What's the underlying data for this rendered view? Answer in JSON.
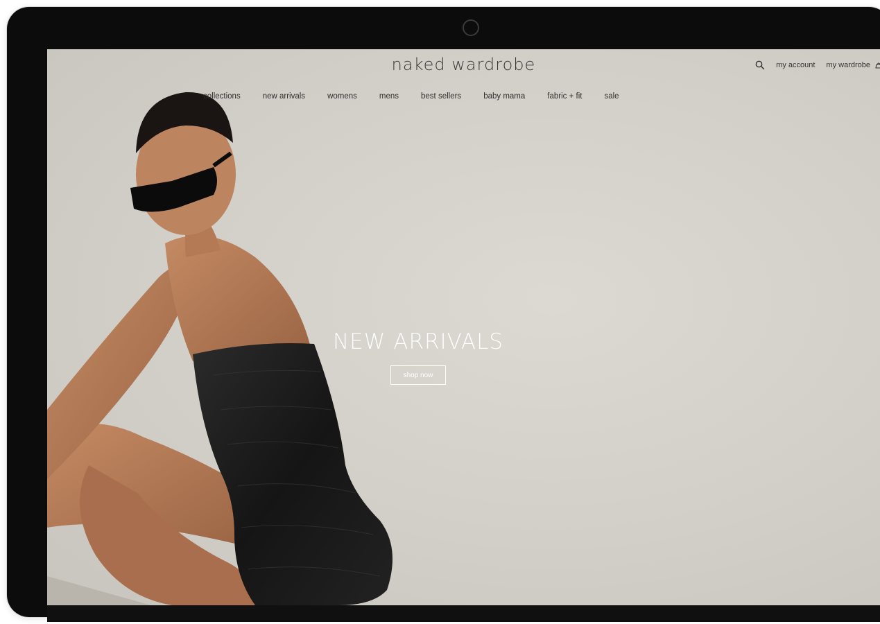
{
  "site": {
    "logo_text": "naked wardrobe"
  },
  "utility": {
    "search_icon": "search-icon",
    "my_account": "my account",
    "my_wardrobe": "my wardrobe",
    "cart_icon": "bag-icon"
  },
  "nav": {
    "items": [
      {
        "label": "collections"
      },
      {
        "label": "new arrivals"
      },
      {
        "label": "womens"
      },
      {
        "label": "mens"
      },
      {
        "label": "best sellers"
      },
      {
        "label": "baby mama"
      },
      {
        "label": "fabric + fit"
      },
      {
        "label": "sale"
      }
    ]
  },
  "hero": {
    "title": "NEW ARRIVALS",
    "cta_label": "shop now",
    "image_description_icon": "model-photo"
  },
  "colors": {
    "background": "#d3d0c9",
    "device_frame": "#0c0c0c",
    "text_dark": "#333333",
    "hero_text": "#ffffff",
    "dress": "#1b1b1b"
  }
}
